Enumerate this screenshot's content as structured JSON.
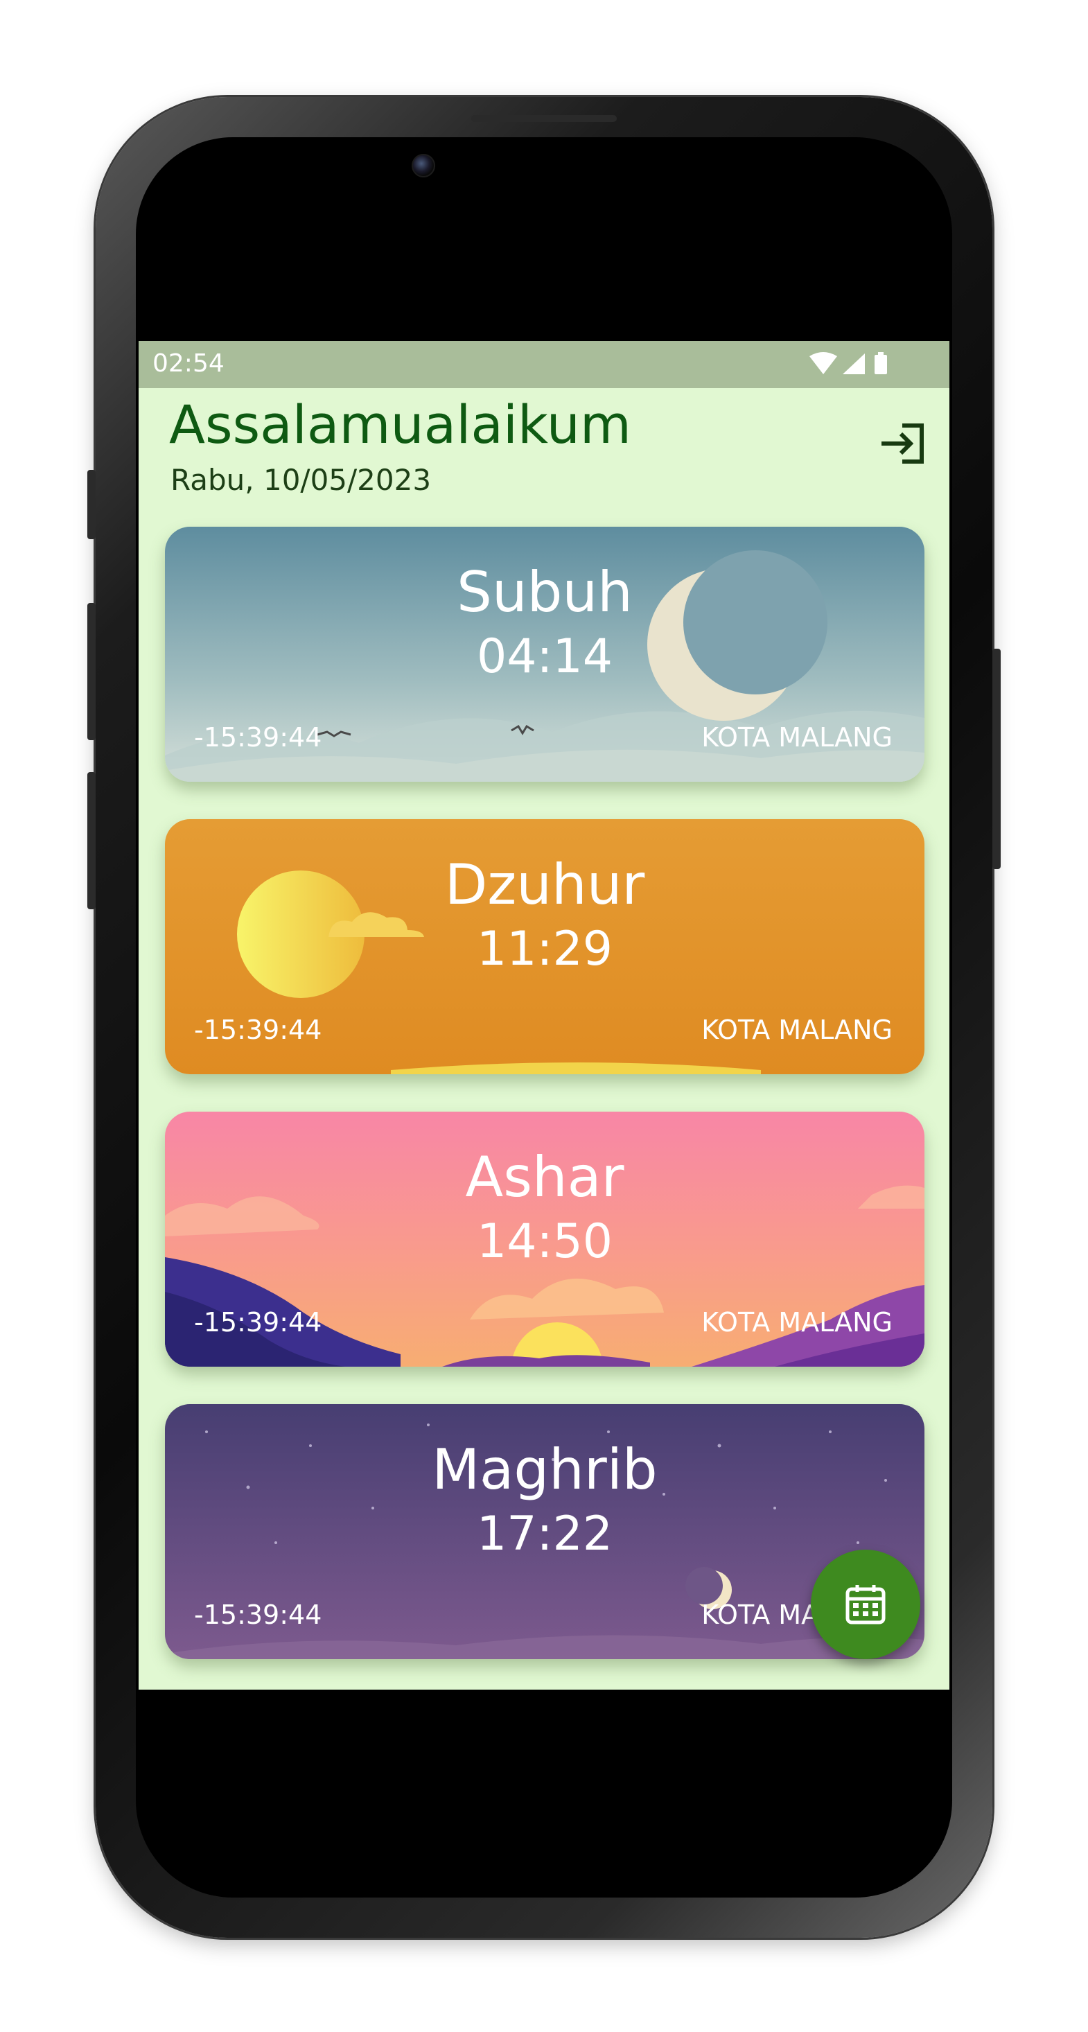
{
  "status_bar": {
    "time": "02:54",
    "icons": [
      "wifi-icon",
      "signal-icon",
      "battery-icon"
    ]
  },
  "header": {
    "greeting": "Assalamualaikum",
    "date": "Rabu, 10/05/2023",
    "logout_icon": "logout-icon"
  },
  "prayers": [
    {
      "name": "Subuh",
      "time": "04:14",
      "countdown": "-15:39:44",
      "city": "KOTA MALANG"
    },
    {
      "name": "Dzuhur",
      "time": "11:29",
      "countdown": "-15:39:44",
      "city": "KOTA MALANG"
    },
    {
      "name": "Ashar",
      "time": "14:50",
      "countdown": "-15:39:44",
      "city": "KOTA MALANG"
    },
    {
      "name": "Maghrib",
      "time": "17:22",
      "countdown": "-15:39:44",
      "city": "KOTA MALANG"
    }
  ],
  "fab": {
    "icon": "calendar-icon"
  },
  "colors": {
    "background": "#e1f8d2",
    "status_bar": "#a9bd9a",
    "greeting": "#0e5a12",
    "fab": "#3e8a1f"
  }
}
